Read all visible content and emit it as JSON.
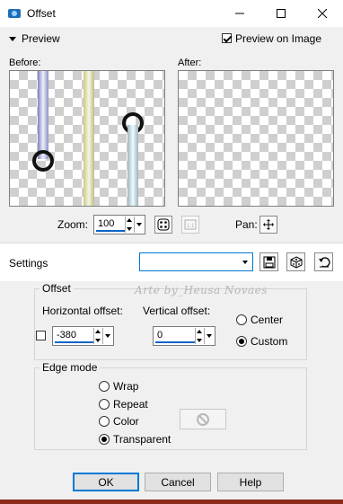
{
  "window": {
    "title": "Offset",
    "minimize_icon": "minimize-icon",
    "maximize_icon": "maximize-icon",
    "close_icon": "close-icon"
  },
  "preview": {
    "header": "Preview",
    "preview_on_image_label": "Preview on Image",
    "preview_on_image_checked": true,
    "before_label": "Before:",
    "after_label": "After:",
    "zoom_label": "Zoom:",
    "zoom_value": "100",
    "pan_label": "Pan:"
  },
  "settings": {
    "label": "Settings",
    "preset_value": ""
  },
  "offset": {
    "group_label": "Offset",
    "horizontal_label": "Horizontal offset:",
    "horizontal_value": "-380",
    "vertical_label": "Vertical offset:",
    "vertical_value": "0",
    "center_label": "Center",
    "custom_label": "Custom",
    "selected": "Custom"
  },
  "watermark": "Arte by_Heusa Novaes",
  "edge_mode": {
    "group_label": "Edge mode",
    "options": [
      "Wrap",
      "Repeat",
      "Color",
      "Transparent"
    ],
    "selected": "Transparent"
  },
  "buttons": {
    "ok": "OK",
    "cancel": "Cancel",
    "help": "Help"
  },
  "colors": {
    "accent": "#0078d7",
    "checker": "#cfcfcf",
    "footer_strip": "#8a2a1a"
  }
}
